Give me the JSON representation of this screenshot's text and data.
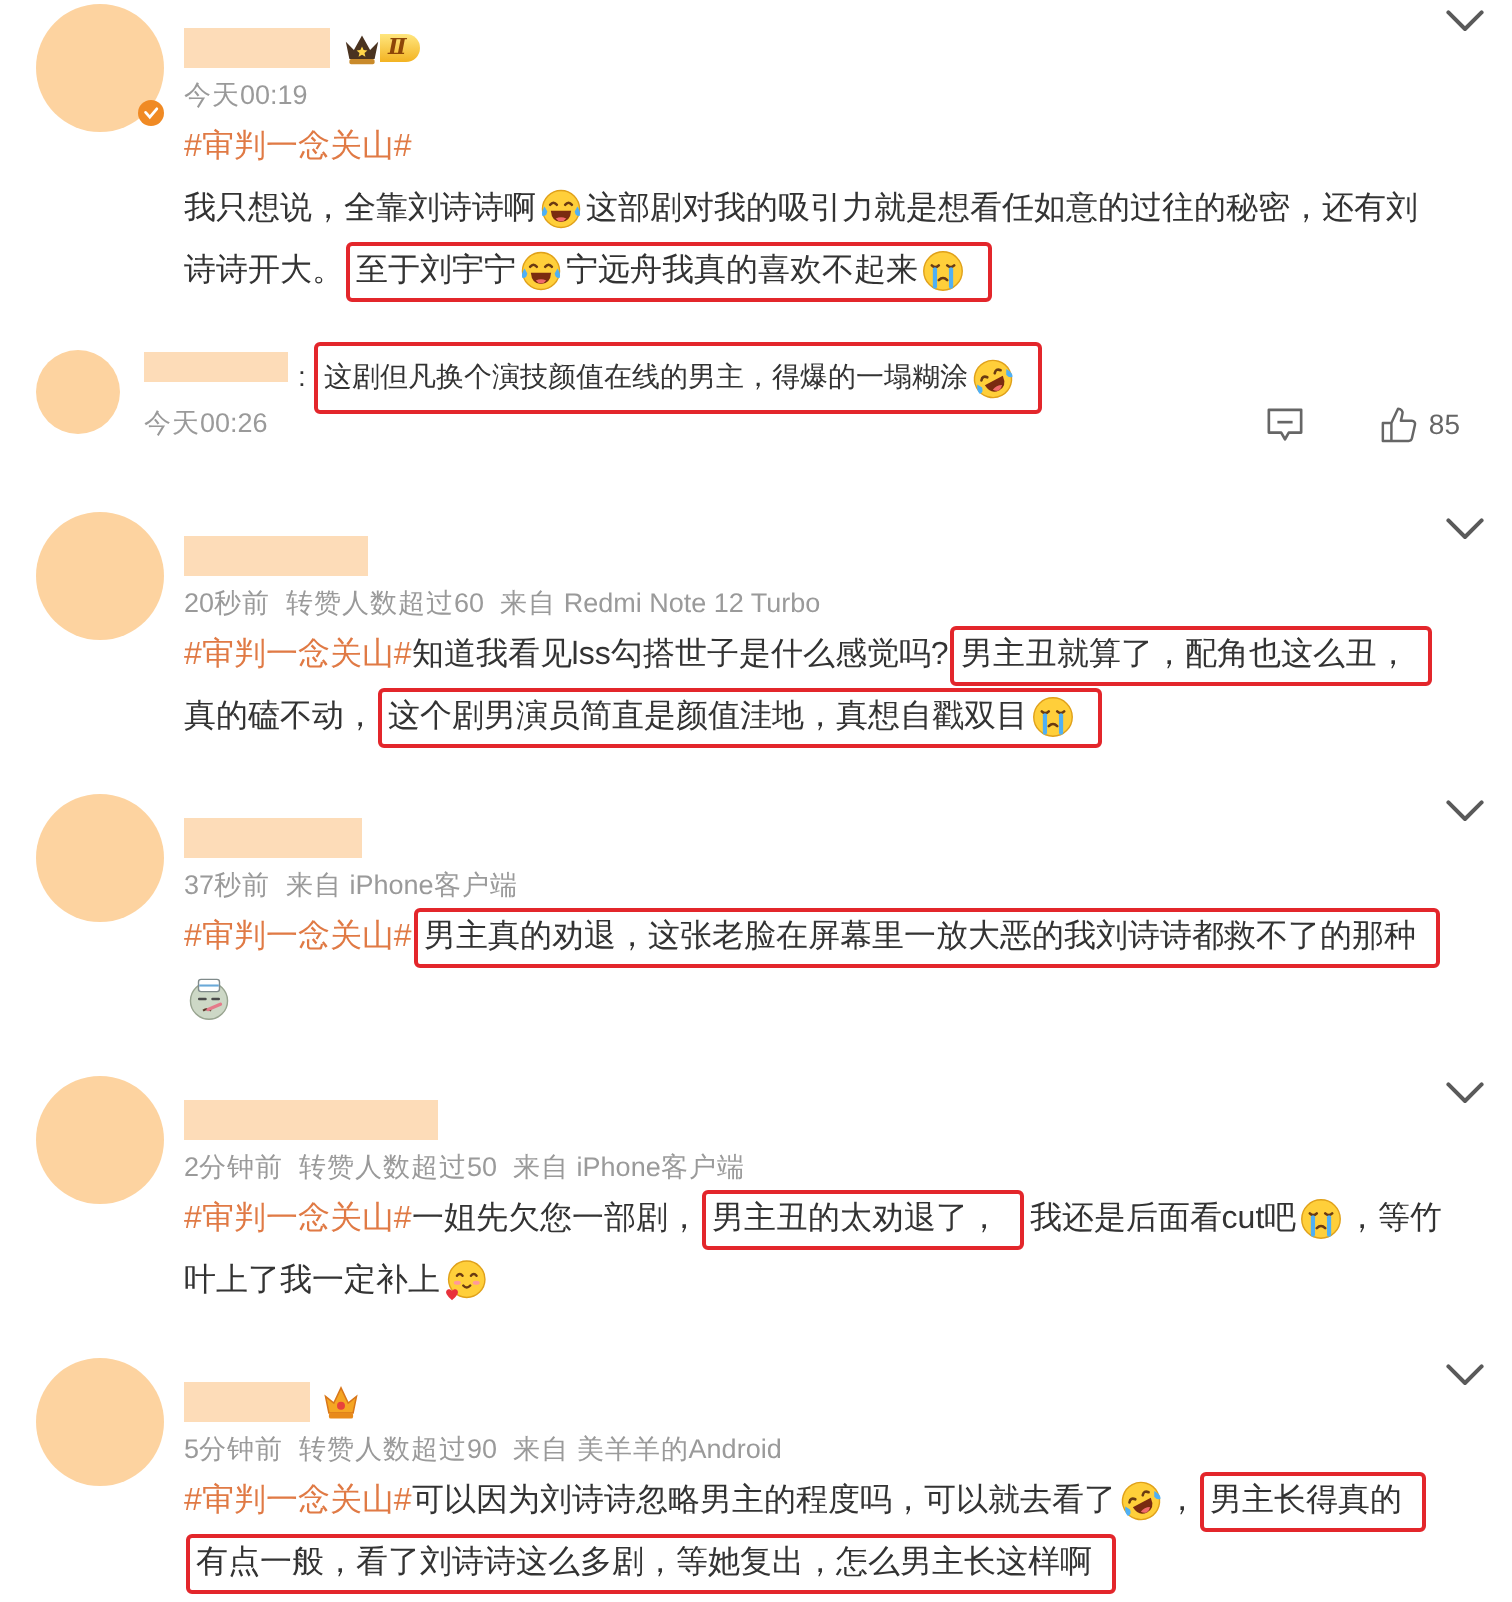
{
  "posts": [
    {
      "user": {
        "redacted": true,
        "verified": true,
        "badge": {
          "kind": "level",
          "text": "Ⅱ"
        }
      },
      "meta": {
        "time": "今天00:19"
      },
      "lines": [
        [
          {
            "kind": "tag",
            "text": "#审判一念关山#"
          }
        ],
        [
          {
            "kind": "text",
            "text": "我只想说，全靠刘诗诗啊"
          },
          {
            "kind": "laughing"
          },
          {
            "kind": "text",
            "text": "这部剧对我的吸引力就是想看任如意的过往的秘密，还有刘"
          }
        ],
        [
          {
            "kind": "text",
            "text": "诗诗开大。"
          },
          {
            "kind": "box",
            "items": [
              {
                "kind": "text",
                "text": "至于刘宇宁"
              },
              {
                "kind": "laughing"
              },
              {
                "kind": "text",
                "text": "宁远舟我真的喜欢不起来"
              },
              {
                "kind": "crying"
              }
            ]
          }
        ]
      ],
      "replies": [
        {
          "user": {
            "redacted": true
          },
          "separator": ":",
          "lines": [
            [
              {
                "kind": "box",
                "items": [
                  {
                    "kind": "text",
                    "text": "这剧但凡换个演技颜值在线的男主，得爆的一塌糊涂"
                  },
                  {
                    "kind": "rolling"
                  }
                ]
              }
            ]
          ],
          "time": "今天00:26",
          "likes": "85"
        }
      ]
    },
    {
      "user": {
        "redacted": true
      },
      "meta": {
        "time": "20秒前",
        "reposts": "转赞人数超过60",
        "source": "来自 Redmi Note 12 Turbo"
      },
      "lines": [
        [
          {
            "kind": "tag",
            "text": "#审判一念关山#"
          },
          {
            "kind": "text",
            "text": "知道我看见lss勾搭世子是什么感觉吗?"
          },
          {
            "kind": "box",
            "items": [
              {
                "kind": "text",
                "text": "男主丑就算了，配角也这么丑，"
              }
            ]
          }
        ],
        [
          {
            "kind": "text",
            "text": "真的磕不动，"
          },
          {
            "kind": "box",
            "items": [
              {
                "kind": "text",
                "text": "这个剧男演员简直是颜值洼地，真想自戳双目"
              },
              {
                "kind": "crying"
              }
            ]
          }
        ]
      ]
    },
    {
      "user": {
        "redacted": true
      },
      "meta": {
        "time": "37秒前",
        "source": "来自 iPhone客户端"
      },
      "lines": [
        [
          {
            "kind": "tag",
            "text": "#审判一念关山#"
          },
          {
            "kind": "box",
            "items": [
              {
                "kind": "text",
                "text": "男主真的劝退，这张老脸在屏幕里一放大恶的我刘诗诗都救不了的那种"
              }
            ]
          }
        ],
        [
          {
            "kind": "sick"
          }
        ]
      ]
    },
    {
      "user": {
        "redacted": true
      },
      "meta": {
        "time": "2分钟前",
        "reposts": "转赞人数超过50",
        "source": "来自 iPhone客户端"
      },
      "lines": [
        [
          {
            "kind": "tag",
            "text": "#审判一念关山#"
          },
          {
            "kind": "text",
            "text": "一姐先欠您一部剧，"
          },
          {
            "kind": "box",
            "items": [
              {
                "kind": "text",
                "text": "男主丑的太劝退了，"
              }
            ]
          },
          {
            "kind": "text",
            "text": "我还是后面看cut吧"
          },
          {
            "kind": "crying"
          },
          {
            "kind": "text",
            "text": "，等竹"
          }
        ],
        [
          {
            "kind": "text",
            "text": "叶上了我一定补上"
          },
          {
            "kind": "hearts"
          }
        ]
      ]
    },
    {
      "user": {
        "redacted": true,
        "badge": {
          "kind": "crown"
        }
      },
      "meta": {
        "time": "5分钟前",
        "reposts": "转赞人数超过90",
        "source": "来自 美羊羊的Android"
      },
      "lines": [
        [
          {
            "kind": "tag",
            "text": "#审判一念关山#"
          },
          {
            "kind": "text",
            "text": "可以因为刘诗诗忽略男主的程度吗，可以就去看了"
          },
          {
            "kind": "rolling"
          },
          {
            "kind": "text",
            "text": "，"
          },
          {
            "kind": "box",
            "items": [
              {
                "kind": "text",
                "text": "男主长得真的"
              }
            ]
          }
        ],
        [
          {
            "kind": "box",
            "items": [
              {
                "kind": "text",
                "text": "有点一般，看了刘诗诗这么多剧，等她复出，怎么男主长这样啊"
              }
            ]
          }
        ]
      ]
    }
  ]
}
